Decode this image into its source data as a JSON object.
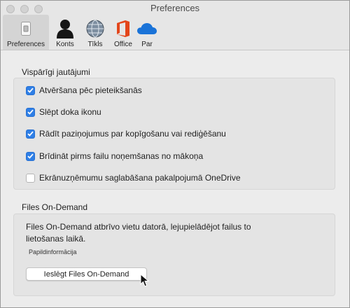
{
  "window": {
    "title": "Preferences"
  },
  "toolbar": {
    "items": [
      {
        "label": "Preferences",
        "icon": "switch-icon",
        "selected": true
      },
      {
        "label": "Konts",
        "icon": "person-icon"
      },
      {
        "label": "Tīkls",
        "icon": "globe-icon"
      },
      {
        "label": "Office",
        "icon": "office-icon"
      },
      {
        "label": "Par",
        "icon": "cloud-icon"
      }
    ]
  },
  "general": {
    "title": "Vispārīgi jautājumi",
    "options": [
      {
        "label": "Atvēršana pēc pieteikšanās",
        "checked": true
      },
      {
        "label": "Slēpt doka ikonu",
        "checked": true
      },
      {
        "label": "Rādīt paziņojumus par kopīgošanu vai rediģēšanu",
        "checked": true
      },
      {
        "label": "Brīdināt pirms failu noņemšanas no mākoņa",
        "checked": true
      },
      {
        "label": "Ekrānuzņēmumu saglabāšana pakalpojumā OneDrive",
        "checked": false
      }
    ]
  },
  "files_on_demand": {
    "title": "Files On-Demand",
    "description": "Files On-Demand atbrīvo vietu datorā, lejupielādējot failus to lietošanas laikā.",
    "more_info": "Papildinformācija",
    "button": "Ieslēgt Files On-Demand"
  },
  "colors": {
    "checkbox": "#2f7fe6",
    "office": "#e3461b",
    "onedrive": "#1a73d8"
  }
}
